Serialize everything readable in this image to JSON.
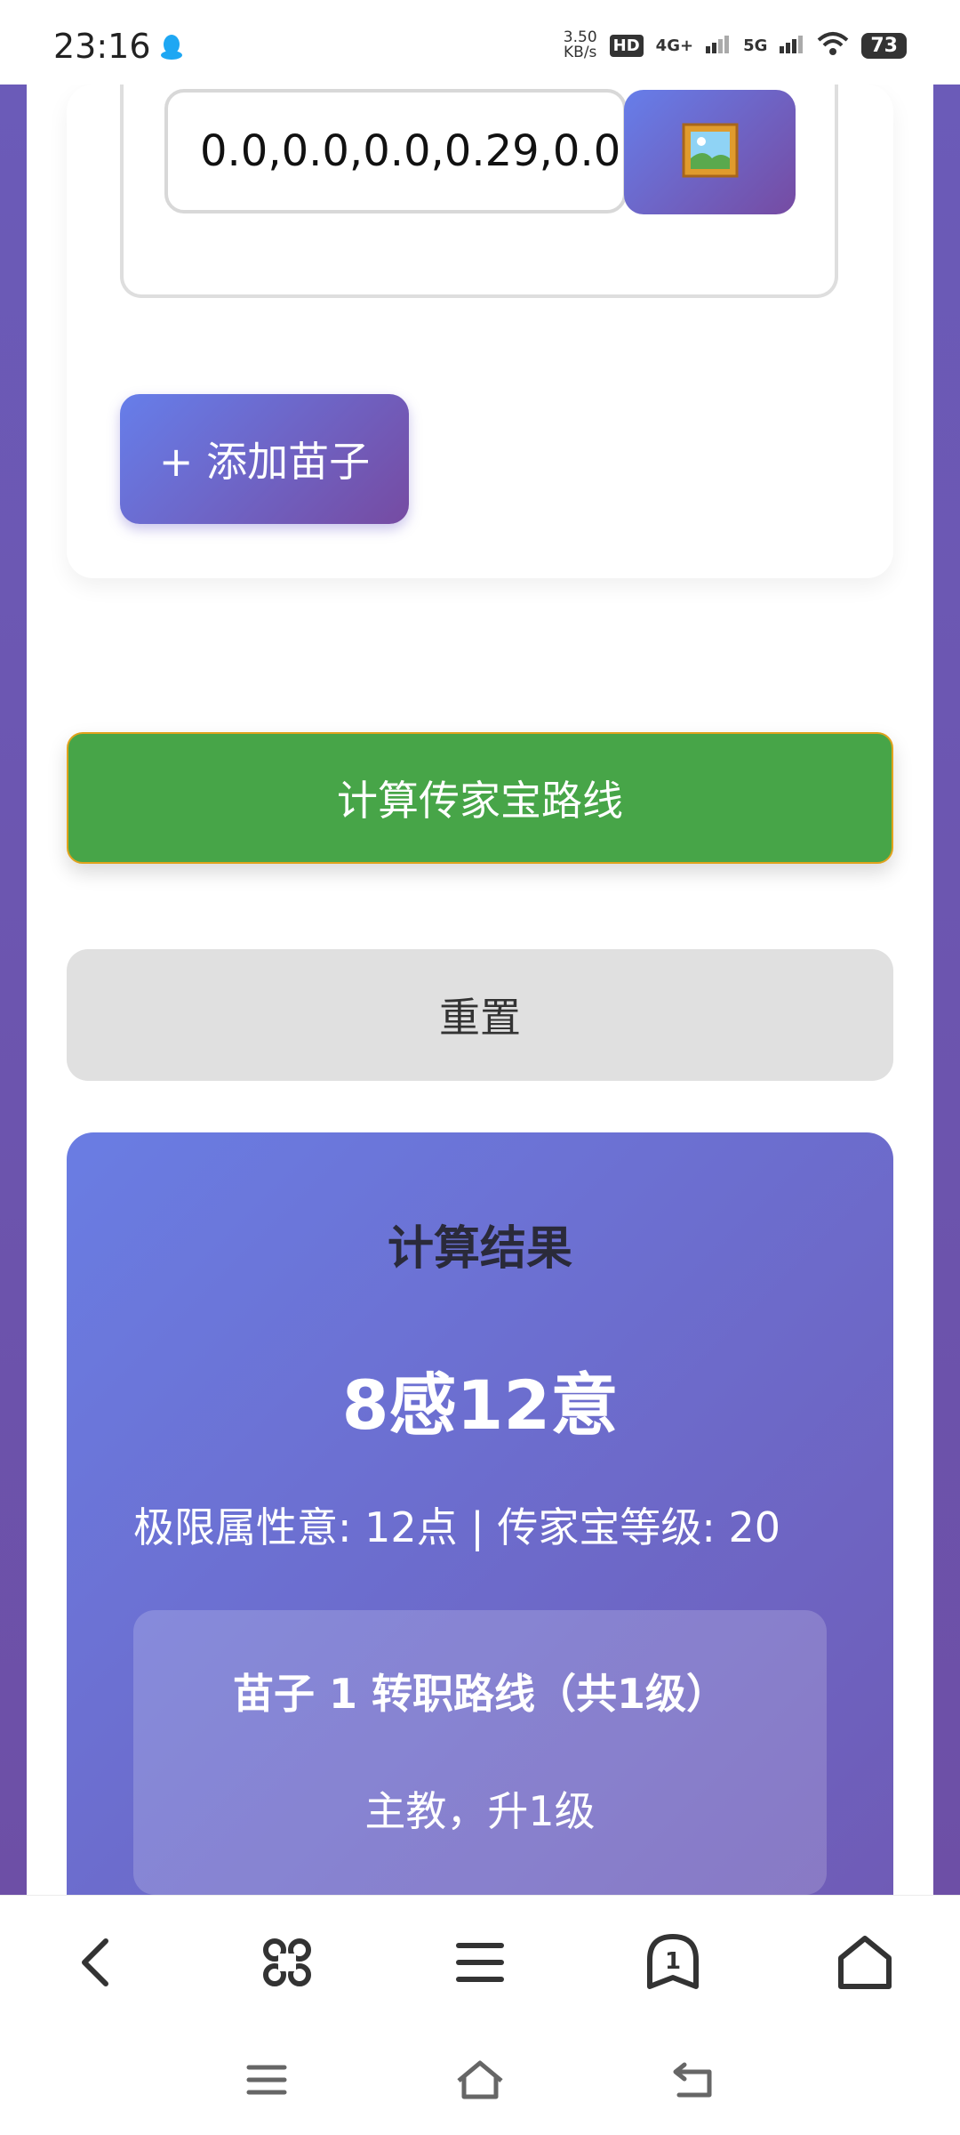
{
  "status_bar": {
    "time": "23:16",
    "speed_value": "3.50",
    "speed_unit": "KB/s",
    "hd_label": "HD",
    "signal_1": "4G+",
    "signal_2": "5G",
    "battery": "73"
  },
  "seedling": {
    "values_input": "0.0,0.0,0.0,0.29,0.0",
    "image_button_icon": "framed-picture-icon"
  },
  "buttons": {
    "add_seedling": "+ 添加苗子",
    "calculate": "计算传家宝路线",
    "reset": "重置"
  },
  "result": {
    "title": "计算结果",
    "value": "8感12意",
    "detail": "极限属性意: 12点 | 传家宝等级: 20",
    "route_title": "苗子 1 转职路线（共1级）",
    "route_step": "主教，升1级"
  },
  "toolbar": {
    "icons": [
      "back-icon",
      "command-icon",
      "menu-icon",
      "tabs-icon",
      "home-icon"
    ],
    "tab_count": "1"
  },
  "colors": {
    "accent_start": "#667eea",
    "accent_end": "#764ba2",
    "calculate_green": "#47a548",
    "reset_gray": "#e0e0e0"
  }
}
